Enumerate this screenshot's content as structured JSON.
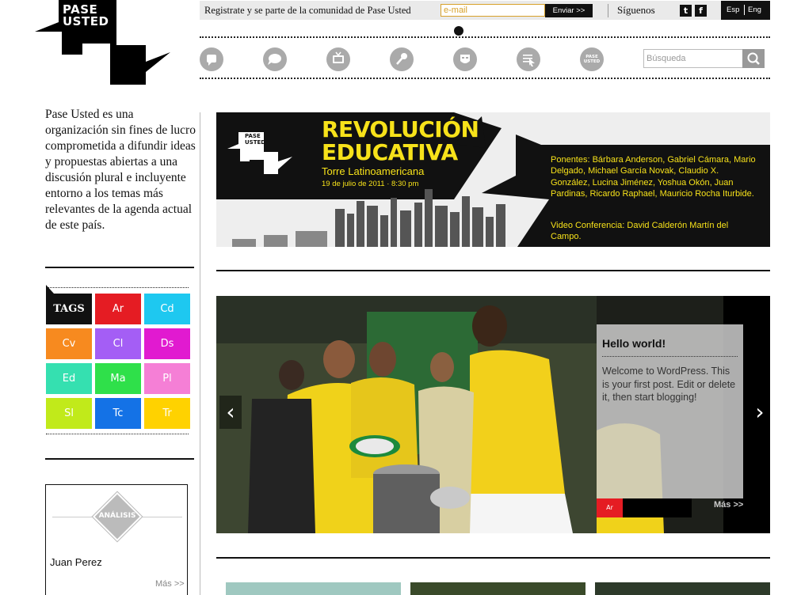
{
  "logo": {
    "line1": "PASE",
    "line2": "USTED"
  },
  "topbar": {
    "register_text": "Registrate y se parte de la comunidad de Pase Usted",
    "email_placeholder": "e-mail",
    "send_label": "Enviar >>",
    "follow_label": "Síguenos",
    "social": [
      {
        "name": "twitter-icon",
        "glyph": "t"
      },
      {
        "name": "facebook-icon",
        "glyph": "f"
      }
    ],
    "lang_es": "Esp",
    "lang_en": "Eng"
  },
  "nav": {
    "icons": [
      "speech-bubble-icon",
      "chat-bubble-icon",
      "tv-icon",
      "microphone-icon",
      "mask-icon",
      "cursor-list-icon",
      "pase-usted-icon"
    ],
    "pase_usted_line1": "PASE",
    "pase_usted_line2": "USTED"
  },
  "search": {
    "placeholder": "Búsqueda"
  },
  "sidebar": {
    "intro": "Pase Usted es una organización sin fines de lucro comprometida a difundir ideas y propuestas abiertas a una discusión plural e incluyente entorno a los temas más relevantes de la agenda actual de este país.",
    "tags_label": "TAGS",
    "tags": [
      {
        "label": "Ar",
        "color": "#e51c23"
      },
      {
        "label": "Cd",
        "color": "#1ec8f0"
      },
      {
        "label": "Cv",
        "color": "#f78a1f"
      },
      {
        "label": "Cl",
        "color": "#a45ef5"
      },
      {
        "label": "Ds",
        "color": "#e11ad0"
      },
      {
        "label": "Ed",
        "color": "#35e0b0"
      },
      {
        "label": "Ma",
        "color": "#2fe04a"
      },
      {
        "label": "Pl",
        "color": "#f57fd6"
      },
      {
        "label": "Sl",
        "color": "#c1ea1a"
      },
      {
        "label": "Tc",
        "color": "#1472e6"
      },
      {
        "label": "Tr",
        "color": "#ffd200"
      }
    ],
    "analysis": {
      "badge": "ANÁLISIS",
      "author": "Juan Perez",
      "more": "Más >>"
    }
  },
  "banner": {
    "logo_line1": "PASE",
    "logo_line2": "USTED",
    "title_line1": "REVOLUCIÓN",
    "title_line2": "EDUCATIVA",
    "venue": "Torre Latinoamericana",
    "date": "19 de julio de 2011 · 8:30 pm",
    "speakers": "Ponentes: Bárbara Anderson, Gabriel Cámara, Mario Delgado, Michael García Novak, Claudio X. González, Lucina Jiménez, Yoshua Okón, Juan Pardinas, Ricardo Raphael, Mauricio Rocha Iturbide.",
    "video": "Video Conferencia: David Calderón Martín del Campo."
  },
  "slider": {
    "prev": "‹",
    "next": "›",
    "caption_title": "Hello world!",
    "caption_text": "Welcome to WordPress. This is your first post. Edit or delete it, then start blogging!",
    "caption_tag": "Ar",
    "caption_tag_color": "#e51c23",
    "more": "Más >>"
  },
  "colors": {
    "accent_yellow": "#f7e21a",
    "gray": "#aaaaaa",
    "dark": "#111111"
  }
}
